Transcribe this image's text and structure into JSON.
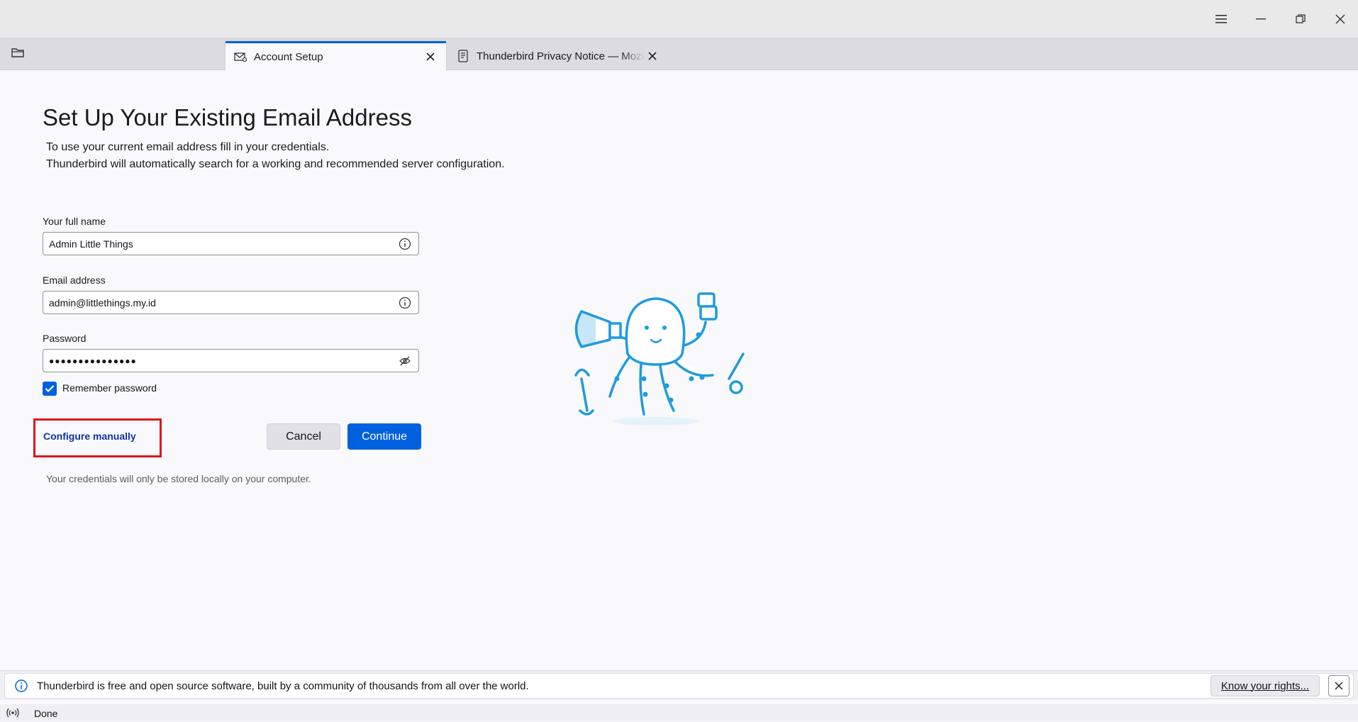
{
  "window": {
    "controls": [
      "menu-icon",
      "minimize-icon",
      "restore-icon",
      "close-icon"
    ]
  },
  "tabs": [
    {
      "label": "Account Setup",
      "icon": "mail-setup-icon",
      "active": true
    },
    {
      "label": "Thunderbird Privacy Notice — Mozi",
      "icon": "document-icon",
      "active": false
    }
  ],
  "form": {
    "title": "Set Up Your Existing Email Address",
    "description_line1": "To use your current email address fill in your credentials.",
    "description_line2": "Thunderbird will automatically search for a working and recommended server configuration.",
    "full_name_label": "Your full name",
    "full_name_value": "Admin Little Things",
    "email_label": "Email address",
    "email_value": "admin@littlethings.my.id",
    "password_label": "Password",
    "password_value": "●●●●●●●●●●●●●●●",
    "remember_label": "Remember password",
    "remember_checked": true,
    "configure_manually": "Configure manually",
    "cancel_label": "Cancel",
    "continue_label": "Continue",
    "credentials_note": "Your credentials will only be stored locally on your computer."
  },
  "notification": {
    "text": "Thunderbird is free and open source software, built by a community of thousands from all over the world.",
    "button": "Know your rights..."
  },
  "status": {
    "text": "Done"
  },
  "colors": {
    "accent": "#0061e0",
    "highlight_box": "#e0141e",
    "link": "#0f33a8",
    "illustration": "#1f9bde"
  }
}
